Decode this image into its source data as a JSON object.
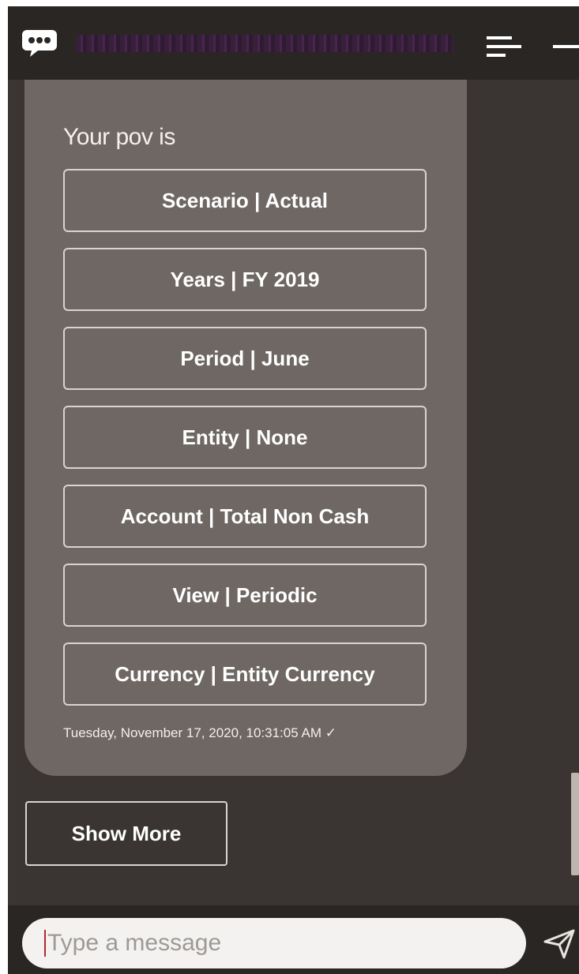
{
  "header": {
    "icons": {
      "chat": "chat-bubble-icon",
      "menu": "hamburger-menu-icon",
      "minimize": "minimize-icon"
    }
  },
  "message": {
    "heading": "Your pov is",
    "pov_buttons": [
      "Scenario | Actual",
      "Years | FY 2019",
      "Period | June",
      "Entity | None",
      "Account | Total Non Cash",
      "View | Periodic",
      "Currency | Entity Currency"
    ],
    "timestamp": "Tuesday, November 17, 2020, 10:31:05 AM ✓"
  },
  "show_more_label": "Show More",
  "composer": {
    "placeholder": "Type a message",
    "send_icon": "send-icon"
  },
  "colors": {
    "header_bg": "#2a2624",
    "conversation_bg": "#3a3532",
    "bubble_bg": "#6f6763",
    "text": "#ffffff"
  }
}
